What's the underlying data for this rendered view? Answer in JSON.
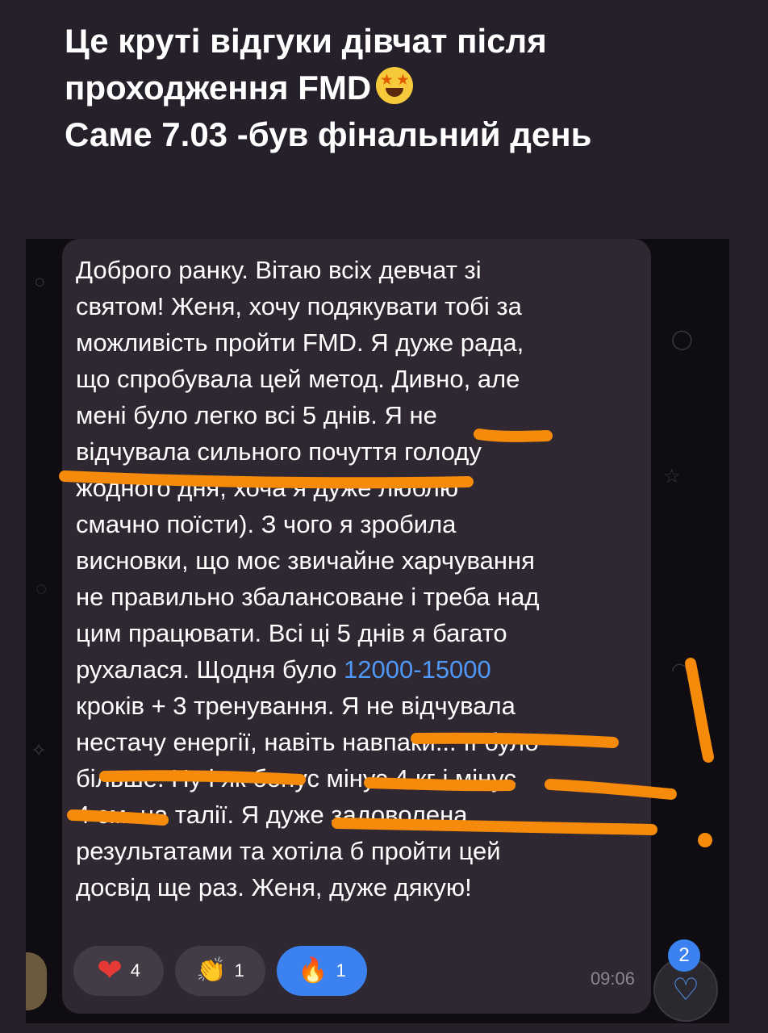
{
  "header": {
    "line1": "Це круті відгуки дівчат після",
    "line2": "проходження FMD",
    "line3": "Саме 7.03 -був фінальний день",
    "emoji": "star-struck-emoji"
  },
  "message": {
    "lines": [
      "Доброго ранку. Вітаю всіх девчат зі",
      "святом!  Женя, хочу подякувати тобі за",
      "можливість пройти FMD. Я дуже рада,",
      "що спробувала цей метод. Дивно, але",
      "мені було легко всі 5 днів. Я не",
      "відчувала сильного почуття голоду",
      "жодного дня, хоча я дуже люблю",
      "смачно поїсти). З чого я зробила",
      "висновки, що моє звичайне харчування",
      "не правильно збалансоване і треба над",
      "цим працювати. Всі ці 5 днів я багато",
      "рухалася. Щодня було ",
      "кроків + 3 тренування. Я не відчувала",
      "нестачу енергії, навіть навпаки... її було",
      "більше. Ну і як бонус мінус 4 кг і мінус",
      "4 см. на талії. Я дуже задоволена",
      "результатами та хотіла б пройти цей",
      "досвід ще раз. Женя, дуже дякую!"
    ],
    "link_text": "12000-15000",
    "time": "09:06"
  },
  "reactions": [
    {
      "icon": "heart-icon",
      "glyph": "❤",
      "count": "4",
      "active": false
    },
    {
      "icon": "clap-icon",
      "glyph": "👏",
      "count": "1",
      "active": false
    },
    {
      "icon": "fire-icon",
      "glyph": "🔥",
      "count": "1",
      "active": true
    }
  ],
  "fab": {
    "badge": "2",
    "icon": "heart-outline-icon"
  },
  "colors": {
    "highlight": "#f58a0b",
    "link": "#4f98f5",
    "accent": "#3b82f0"
  }
}
